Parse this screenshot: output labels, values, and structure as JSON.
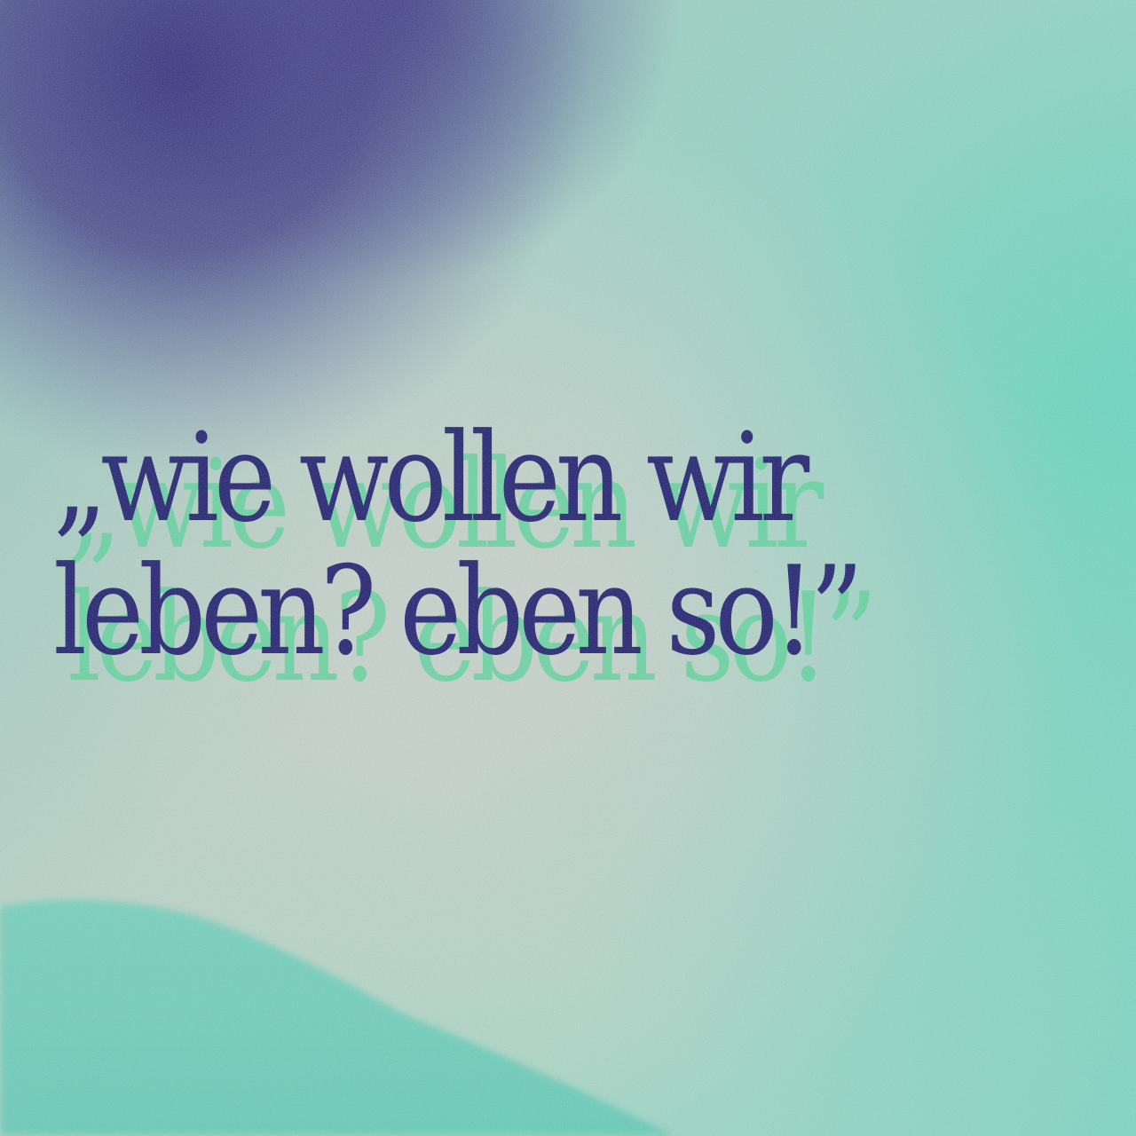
{
  "quote": {
    "line1": "„wie wollen wir",
    "line2": "leben? eben so!”"
  },
  "colors": {
    "text": "#1b1a6e",
    "text_shadow": "#56d79a",
    "bg_teal": "#6fd6c0",
    "bg_pale": "#c3d6cc",
    "bg_indigo": "#33307f",
    "hill": "#62cfbc"
  }
}
